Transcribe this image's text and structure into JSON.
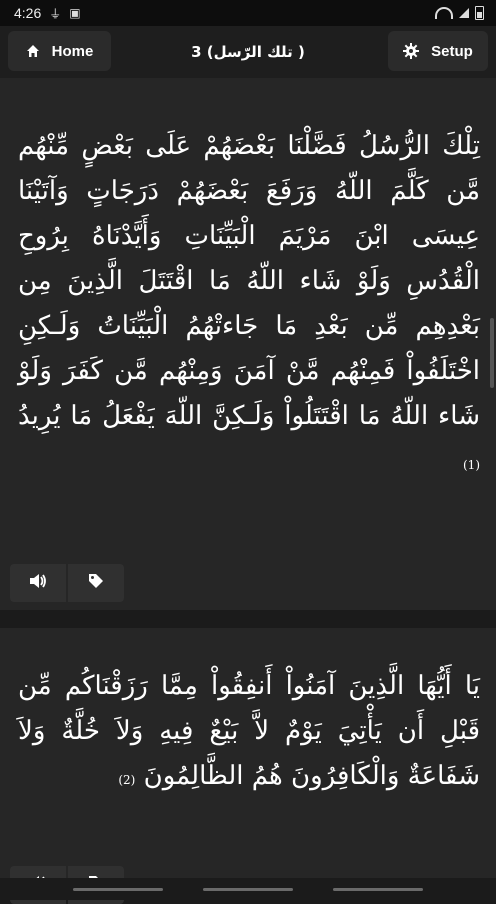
{
  "status_bar": {
    "time": "4:26",
    "icons": [
      "usb-icon",
      "image-icon",
      "wifi-icon",
      "signal-icon",
      "battery-icon"
    ]
  },
  "toolbar": {
    "home_label": "Home",
    "setup_label": "Setup",
    "title": "3 (تلك الرّسل )"
  },
  "verses": [
    {
      "text": "تِلْكَ الرُّسُلُ فَضَّلْنَا بَعْضَهُمْ عَلَى بَعْضٍ مِّنْهُم مَّن كَلَّمَ اللّهُ وَرَفَعَ بَعْضَهُمْ دَرَجَاتٍ وَآتَيْنَا عِيسَى ابْنَ مَرْيَمَ الْبَيِّنَاتِ وَأَيَّدْنَاهُ بِرُوحِ الْقُدُسِ وَلَوْ شَاء اللّهُ مَا اقْتَتَلَ الَّذِينَ مِن بَعْدِهِم مِّن بَعْدِ مَا جَاءتْهُمُ الْبَيِّنَاتُ وَلَـكِنِ اخْتَلَفُواْ فَمِنْهُم مَّنْ آمَنَ وَمِنْهُم مَّن كَفَرَ وَلَوْ شَاء اللّهُ مَا اقْتَتَلُواْ وَلَـكِنَّ اللّهَ يَفْعَلُ مَا يُرِيدُ",
      "number": "(1)"
    },
    {
      "text": "يَا أَيُّهَا الَّذِينَ آمَنُواْ أَنفِقُواْ مِمَّا رَزَقْنَاكُم مِّن قَبْلِ أَن يَأْتِيَ يَوْمٌ لاَّ بَيْعٌ فِيهِ وَلاَ خُلَّةٌ وَلاَ شَفَاعَةٌ وَالْكَافِرُونَ هُمُ الظَّالِمُونَ",
      "number": "(2)"
    }
  ],
  "icons": {
    "home": "home-icon",
    "setup": "gear-icon",
    "play": "speaker-icon",
    "tag": "tag-icon"
  },
  "colors": {
    "background": "#1b1b1b",
    "card": "#262626",
    "button": "#2b2b2b",
    "text": "#ffffff"
  }
}
